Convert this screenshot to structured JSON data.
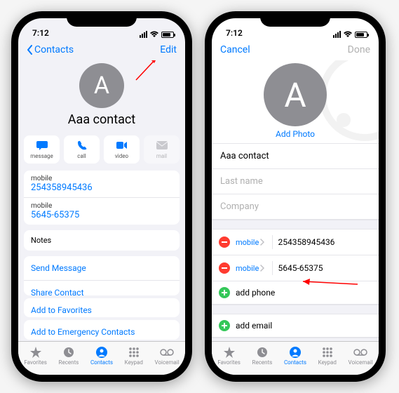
{
  "status": {
    "time": "7:12"
  },
  "left": {
    "nav": {
      "back": "Contacts",
      "edit": "Edit"
    },
    "avatar_letter": "A",
    "name": "Aaa contact",
    "actions": {
      "message": "message",
      "call": "call",
      "video": "video",
      "mail": "mail"
    },
    "phones": [
      {
        "label": "mobile",
        "number": "254358945436"
      },
      {
        "label": "mobile",
        "number": "5645-65375"
      }
    ],
    "notes_label": "Notes",
    "link_send_message": "Send Message",
    "link_share_contact": "Share Contact",
    "link_add_fav": "Add to Favorites",
    "link_emergency": "Add to Emergency Contacts"
  },
  "right": {
    "nav": {
      "cancel": "Cancel",
      "done": "Done"
    },
    "avatar_letter": "A",
    "add_photo": "Add Photo",
    "first_name": "Aaa contact",
    "last_name_ph": "Last name",
    "company_ph": "Company",
    "phones": [
      {
        "type": "mobile",
        "number": "254358945436"
      },
      {
        "type": "mobile",
        "number": "5645-65375"
      }
    ],
    "add_phone": "add phone",
    "add_email": "add email"
  },
  "tabs": {
    "favorites": "Favorites",
    "recents": "Recents",
    "contacts": "Contacts",
    "keypad": "Keypad",
    "voicemail": "Voicemail"
  }
}
